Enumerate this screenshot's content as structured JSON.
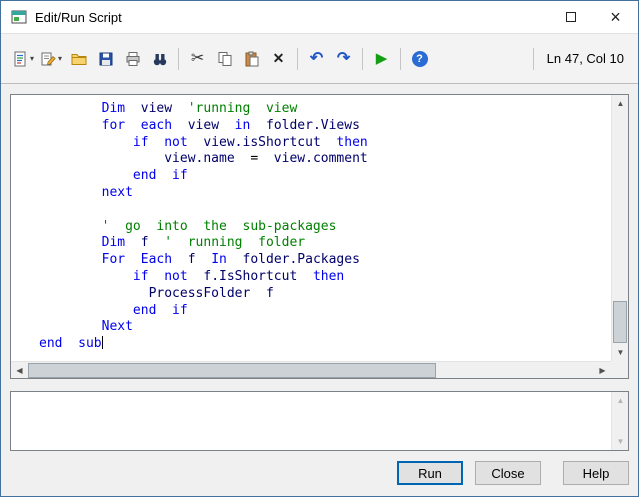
{
  "window": {
    "title": "Edit/Run Script"
  },
  "icons": {
    "dropdown": "▾",
    "cut": "✂",
    "delete": "✕",
    "undo": "↶",
    "redo": "↷",
    "run": "▶",
    "help": "?",
    "close": "×",
    "up": "▲",
    "down": "▼",
    "left": "◀",
    "right": "▶"
  },
  "toolbar": {
    "status": "Ln 47, Col 10",
    "icons": [
      "script-new",
      "edit",
      "open",
      "save",
      "print",
      "find",
      "cut",
      "copy",
      "paste",
      "delete",
      "undo",
      "redo",
      "run",
      "help"
    ]
  },
  "editor": {
    "caret_line": 14,
    "lines": [
      [
        {
          "t": "        Dim",
          "c": "kw"
        },
        {
          "t": "  view",
          "c": "id"
        },
        {
          "t": "  'running  view",
          "c": "cm"
        }
      ],
      [
        {
          "t": "        for  each",
          "c": "kw"
        },
        {
          "t": "  view",
          "c": "id"
        },
        {
          "t": "  in",
          "c": "kw"
        },
        {
          "t": "  folder.Views",
          "c": "id"
        }
      ],
      [
        {
          "t": "            if  not",
          "c": "kw"
        },
        {
          "t": "  view.isShortcut",
          "c": "id"
        },
        {
          "t": "  then",
          "c": "kw"
        }
      ],
      [
        {
          "t": "                view.name",
          "c": "id"
        },
        {
          "t": "  =",
          "c": "op"
        },
        {
          "t": "  view.comment",
          "c": "id"
        }
      ],
      [
        {
          "t": "            end  if",
          "c": "kw"
        }
      ],
      [
        {
          "t": "        next",
          "c": "kw"
        }
      ],
      [],
      [
        {
          "t": "        '  go  into  the  sub-packages",
          "c": "cm"
        }
      ],
      [
        {
          "t": "        Dim",
          "c": "kw"
        },
        {
          "t": "  f",
          "c": "id"
        },
        {
          "t": "  '  running  folder",
          "c": "cm"
        }
      ],
      [
        {
          "t": "        For  Each",
          "c": "kw"
        },
        {
          "t": "  f",
          "c": "id"
        },
        {
          "t": "  In",
          "c": "kw"
        },
        {
          "t": "  folder.Packages",
          "c": "id"
        }
      ],
      [
        {
          "t": "            if  not",
          "c": "kw"
        },
        {
          "t": "  f.IsShortcut",
          "c": "id"
        },
        {
          "t": "  then",
          "c": "kw"
        }
      ],
      [
        {
          "t": "              ProcessFolder  f",
          "c": "id"
        }
      ],
      [
        {
          "t": "            end  if",
          "c": "kw"
        }
      ],
      [
        {
          "t": "        Next",
          "c": "kw"
        }
      ],
      [
        {
          "t": "end  sub",
          "c": "kw"
        }
      ]
    ]
  },
  "output": {
    "text": ""
  },
  "buttons": {
    "run": "Run",
    "close": "Close",
    "help": "Help"
  }
}
